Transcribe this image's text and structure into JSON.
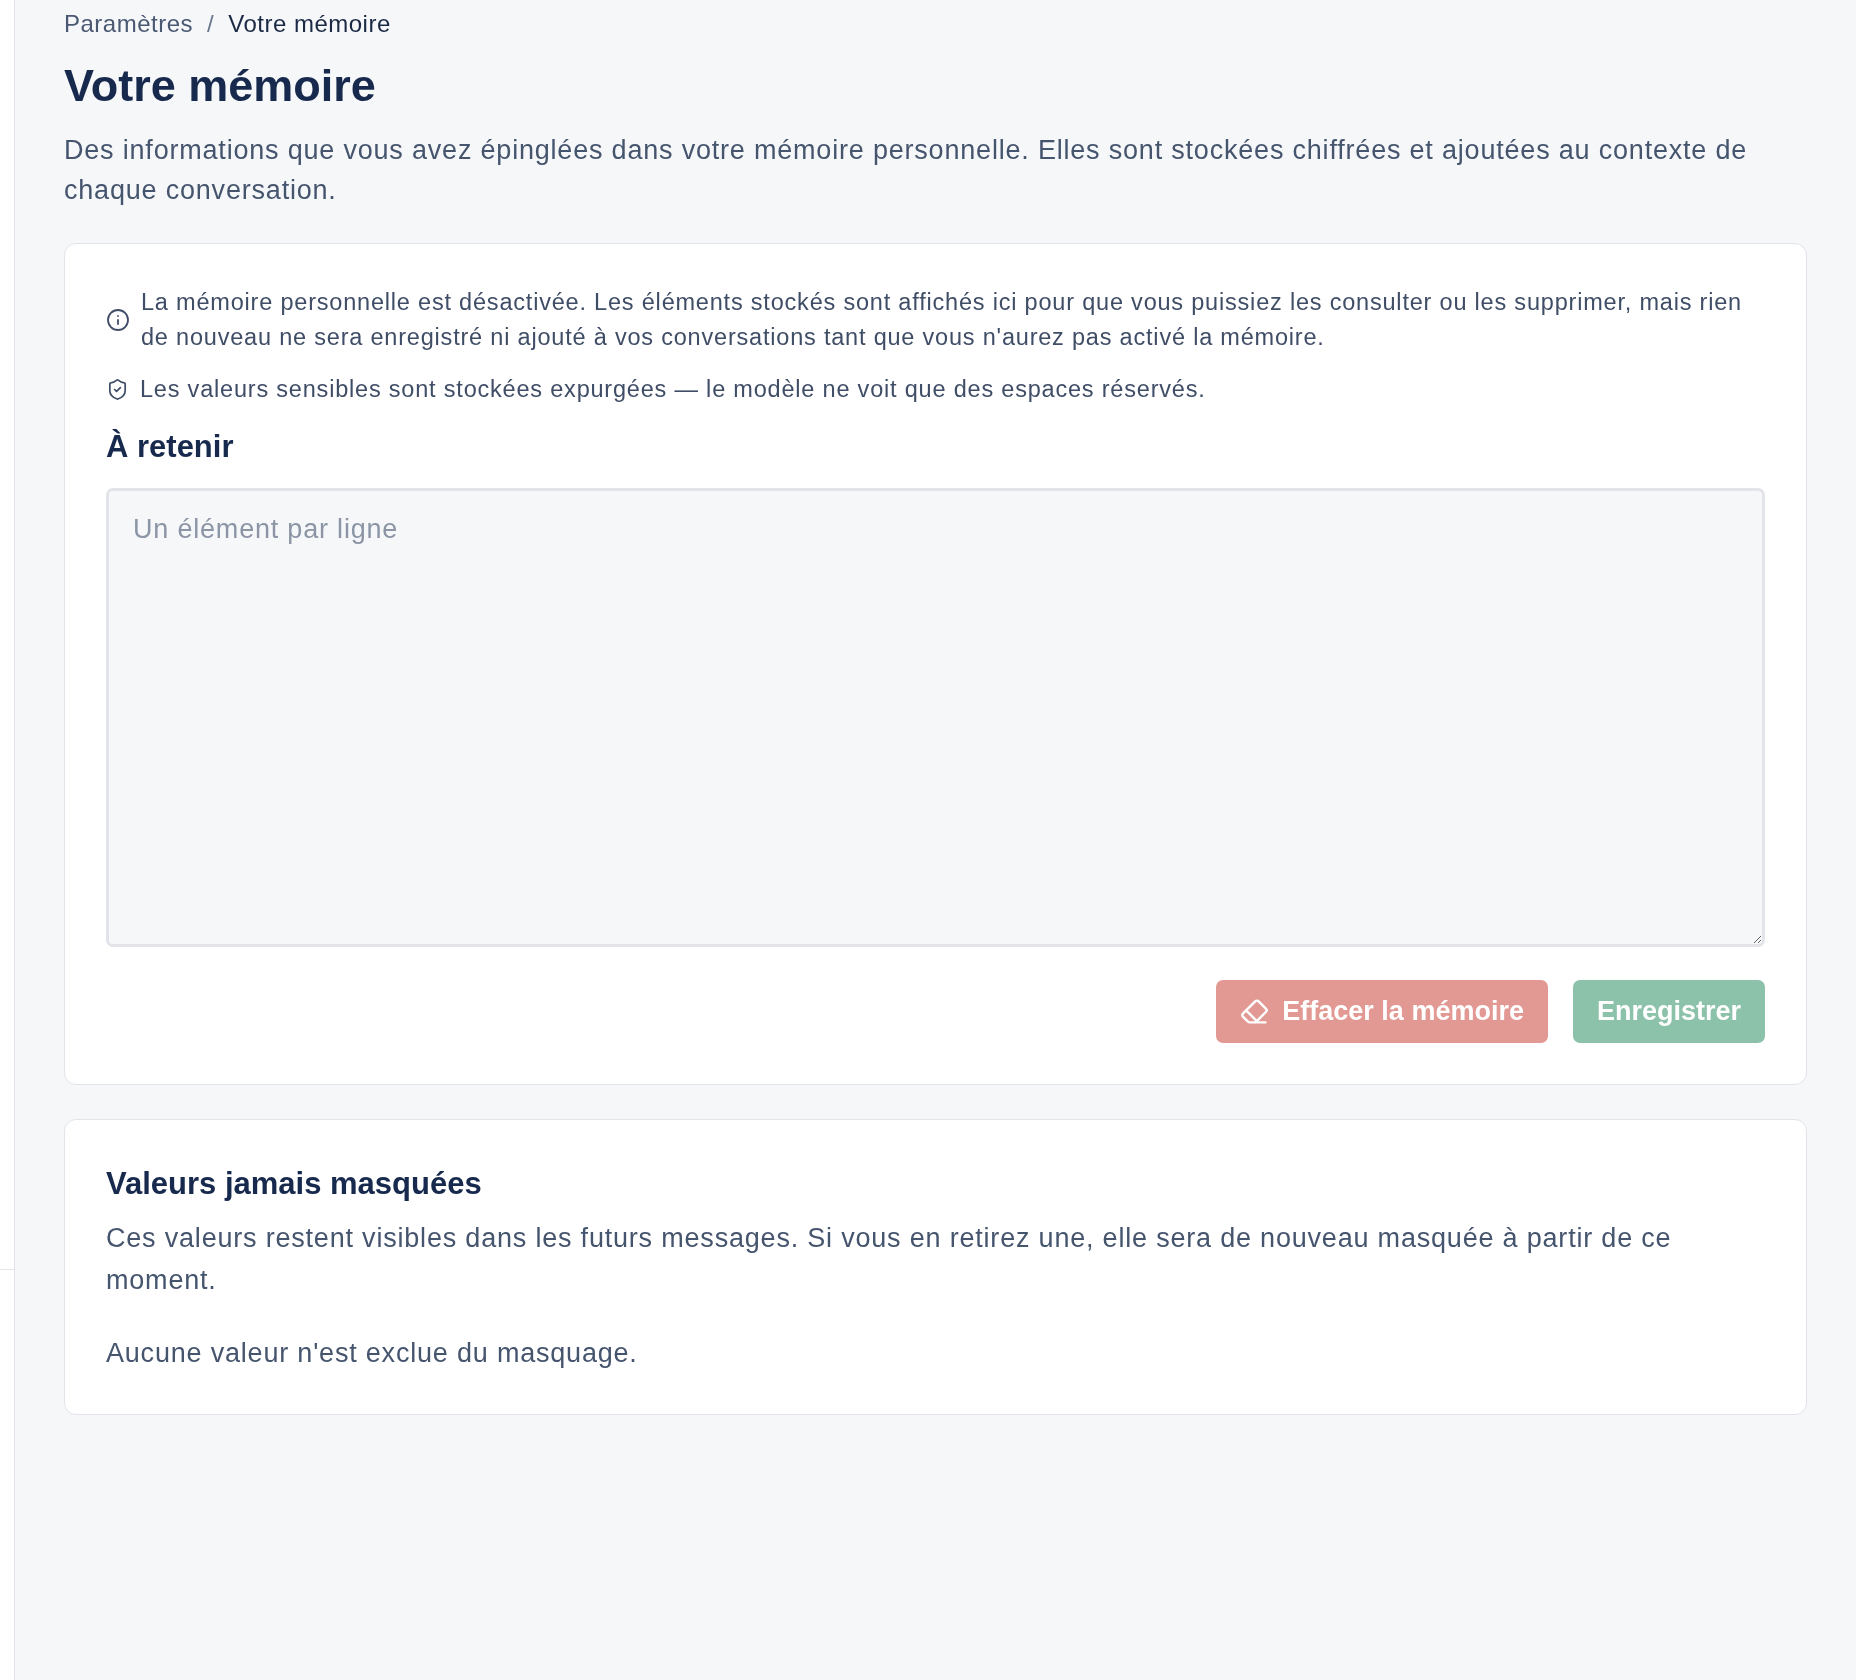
{
  "breadcrumb": {
    "items": [
      {
        "label": "Paramètres",
        "current": false
      },
      {
        "label": "Votre mémoire",
        "current": true
      }
    ],
    "separator": "/"
  },
  "title": "Votre mémoire",
  "description": "Des informations que vous avez épinglées dans votre mémoire personnelle. Elles sont stockées chiffrées et ajoutées au contexte de chaque conversation.",
  "memory_card": {
    "notices": [
      {
        "kind": "info",
        "text": "La mémoire personnelle est désactivée. Les éléments stockés sont affichés ici pour que vous puissiez les consulter ou les supprimer, mais rien de nouveau ne sera enregistré ni ajouté à vos conversations tant que vous n'aurez pas activé la mémoire."
      },
      {
        "kind": "sensitive",
        "text": "Les valeurs sensibles sont stockées expurgées — le modèle ne voit que des espaces réservés."
      }
    ],
    "heading": "À retenir",
    "textarea": {
      "placeholder": "Un élément par ligne"
    },
    "buttons": [
      {
        "kind": "clear",
        "label": "Effacer la mémoire",
        "disabled": true
      },
      {
        "kind": "save",
        "label": "Enregistrer",
        "disabled": true
      }
    ]
  },
  "exclusions_card": {
    "heading": "Valeurs jamais masquées",
    "description": "Ces valeurs restent visibles dans les futurs messages. Si vous en retirez une, elle sera de nouveau masquée à partir de ce moment.",
    "empty_message": "Aucune valeur n'est exclue du masquage."
  }
}
